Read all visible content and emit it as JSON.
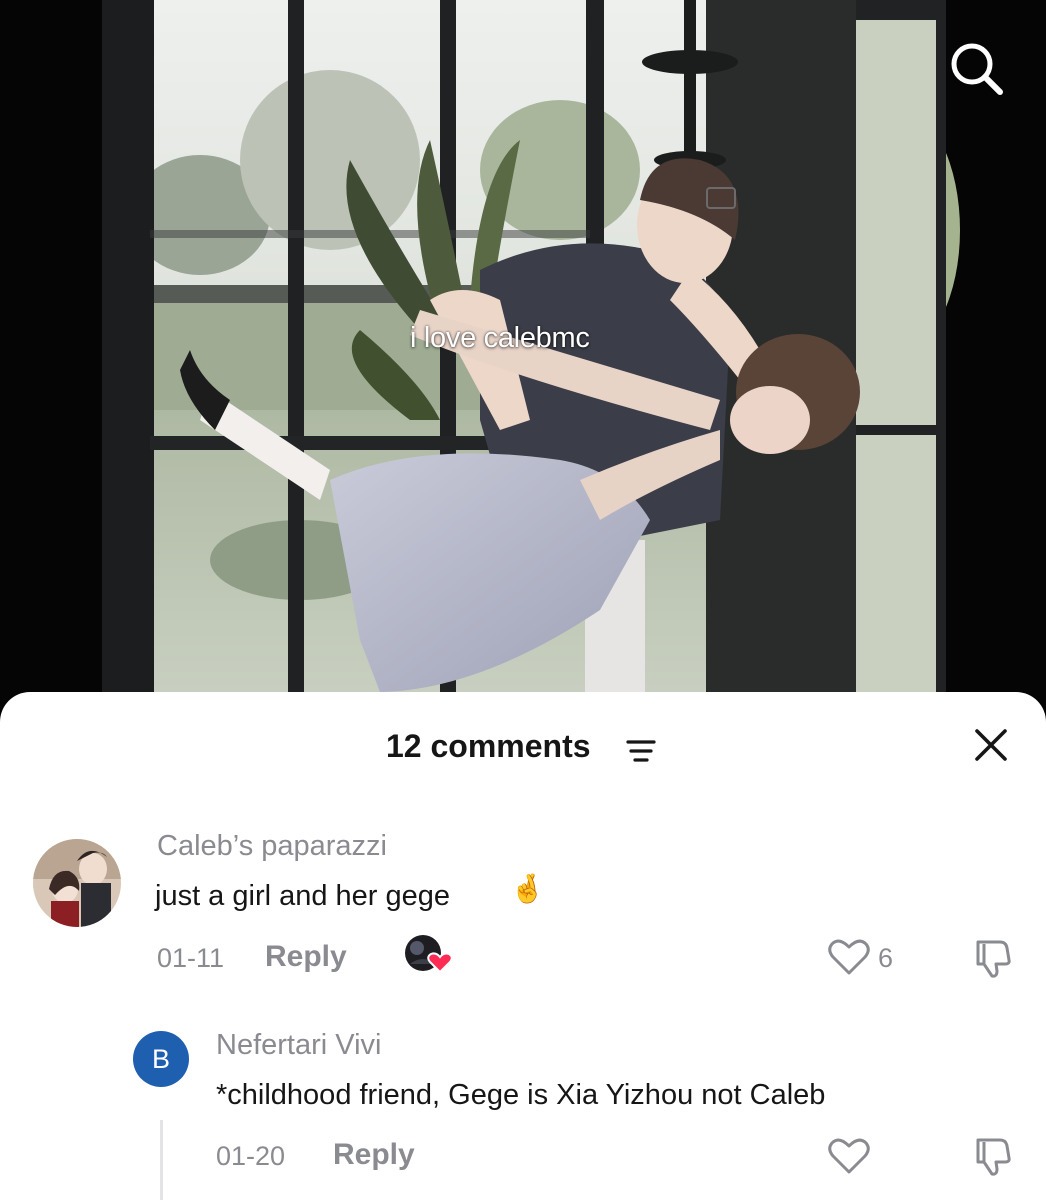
{
  "video": {
    "caption": "i love calebmc",
    "search_icon": "search-icon"
  },
  "comments_panel": {
    "title": "12 comments",
    "sort_icon": "sort-filter-icon",
    "close_icon": "close-icon"
  },
  "comments": [
    {
      "username": "Caleb’s paparazzi",
      "text": "just a girl and her gege",
      "emoji": "🤞",
      "date": "01-11",
      "reply_label": "Reply",
      "likes": "6",
      "liked_by_creator": true
    }
  ],
  "replies": [
    {
      "avatar_letter": "B",
      "username": "Nefertari Vivi",
      "text": "*childhood friend, Gege is Xia Yizhou not Caleb",
      "date": "01-20",
      "reply_label": "Reply"
    }
  ],
  "colors": {
    "accent_like": "#fe2c55",
    "muted_text": "#8a8b91",
    "avatar_b": "#1f5fb0"
  }
}
